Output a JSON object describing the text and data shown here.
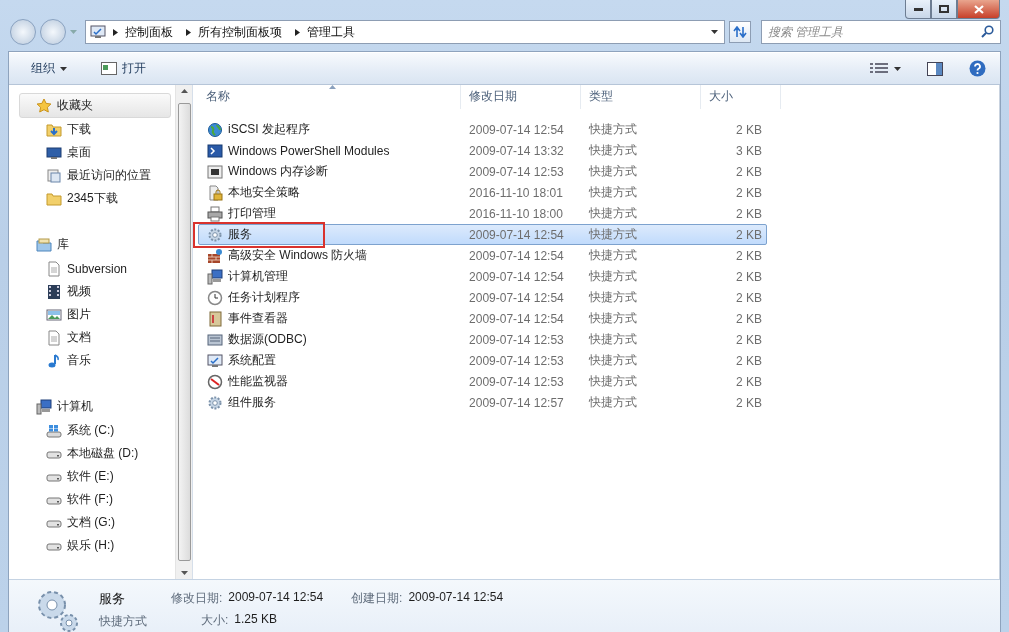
{
  "address": {
    "crumbs": [
      "控制面板",
      "所有控制面板项",
      "管理工具"
    ]
  },
  "search": {
    "placeholder": "搜索 管理工具"
  },
  "toolbar": {
    "buttons": [
      {
        "label": "组织",
        "kind": "menu"
      },
      {
        "label": "打开",
        "kind": "open"
      }
    ]
  },
  "sidebar": {
    "groups": [
      {
        "label": "收藏夹",
        "kind": "star",
        "highlighted": true,
        "items": [
          {
            "label": "下载",
            "kind": "download"
          },
          {
            "label": "桌面",
            "kind": "desktop"
          },
          {
            "label": "最近访问的位置",
            "kind": "recent"
          },
          {
            "label": "2345下载",
            "kind": "folder"
          }
        ]
      },
      {
        "label": "库",
        "kind": "library",
        "highlighted": false,
        "items": [
          {
            "label": "Subversion",
            "kind": "doc"
          },
          {
            "label": "视频",
            "kind": "video"
          },
          {
            "label": "图片",
            "kind": "picture"
          },
          {
            "label": "文档",
            "kind": "doc"
          },
          {
            "label": "音乐",
            "kind": "music"
          }
        ]
      },
      {
        "label": "计算机",
        "kind": "computer",
        "highlighted": false,
        "items": [
          {
            "label": "系统 (C:)",
            "kind": "sysdrive"
          },
          {
            "label": "本地磁盘 (D:)",
            "kind": "drive"
          },
          {
            "label": "软件 (E:)",
            "kind": "drive"
          },
          {
            "label": "软件 (F:)",
            "kind": "drive"
          },
          {
            "label": "文档 (G:)",
            "kind": "drive"
          },
          {
            "label": "娱乐 (H:)",
            "kind": "drive"
          }
        ]
      }
    ]
  },
  "table": {
    "columns": [
      {
        "label": "名称",
        "sorted": true
      },
      {
        "label": "修改日期",
        "sorted": false
      },
      {
        "label": "类型",
        "sorted": false
      },
      {
        "label": "大小",
        "sorted": false
      }
    ],
    "rows": [
      {
        "name": "iSCSI 发起程序",
        "date": "2009-07-14 12:54",
        "type": "快捷方式",
        "size": "2 KB",
        "kind": "globe",
        "selected": false,
        "annotated": false
      },
      {
        "name": "Windows PowerShell Modules",
        "date": "2009-07-14 13:32",
        "type": "快捷方式",
        "size": "3 KB",
        "kind": "terminal",
        "selected": false,
        "annotated": false
      },
      {
        "name": "Windows 内存诊断",
        "date": "2009-07-14 12:53",
        "type": "快捷方式",
        "size": "2 KB",
        "kind": "chip",
        "selected": false,
        "annotated": false
      },
      {
        "name": "本地安全策略",
        "date": "2016-11-10 18:01",
        "type": "快捷方式",
        "size": "2 KB",
        "kind": "lock",
        "selected": false,
        "annotated": false
      },
      {
        "name": "打印管理",
        "date": "2016-11-10 18:00",
        "type": "快捷方式",
        "size": "2 KB",
        "kind": "printer",
        "selected": false,
        "annotated": false
      },
      {
        "name": "服务",
        "date": "2009-07-14 12:54",
        "type": "快捷方式",
        "size": "2 KB",
        "kind": "gear",
        "selected": true,
        "annotated": true
      },
      {
        "name": "高级安全 Windows 防火墙",
        "date": "2009-07-14 12:54",
        "type": "快捷方式",
        "size": "2 KB",
        "kind": "wall",
        "selected": false,
        "annotated": false
      },
      {
        "name": "计算机管理",
        "date": "2009-07-14 12:54",
        "type": "快捷方式",
        "size": "2 KB",
        "kind": "computer",
        "selected": false,
        "annotated": false
      },
      {
        "name": "任务计划程序",
        "date": "2009-07-14 12:54",
        "type": "快捷方式",
        "size": "2 KB",
        "kind": "clock",
        "selected": false,
        "annotated": false
      },
      {
        "name": "事件查看器",
        "date": "2009-07-14 12:54",
        "type": "快捷方式",
        "size": "2 KB",
        "kind": "book",
        "selected": false,
        "annotated": false
      },
      {
        "name": "数据源(ODBC)",
        "date": "2009-07-14 12:53",
        "type": "快捷方式",
        "size": "2 KB",
        "kind": "database",
        "selected": false,
        "annotated": false
      },
      {
        "name": "系统配置",
        "date": "2009-07-14 12:53",
        "type": "快捷方式",
        "size": "2 KB",
        "kind": "monitor",
        "selected": false,
        "annotated": false
      },
      {
        "name": "性能监视器",
        "date": "2009-07-14 12:53",
        "type": "快捷方式",
        "size": "2 KB",
        "kind": "gauge",
        "selected": false,
        "annotated": false
      },
      {
        "name": "组件服务",
        "date": "2009-07-14 12:57",
        "type": "快捷方式",
        "size": "2 KB",
        "kind": "gear",
        "selected": false,
        "annotated": false
      }
    ]
  },
  "details": {
    "name": "服务",
    "type": "快捷方式",
    "fields": [
      {
        "label": "修改日期:",
        "value": "2009-07-14 12:54"
      },
      {
        "label": "大小:",
        "value": "1.25 KB"
      },
      {
        "label": "创建日期:",
        "value": "2009-07-14 12:54"
      }
    ]
  }
}
